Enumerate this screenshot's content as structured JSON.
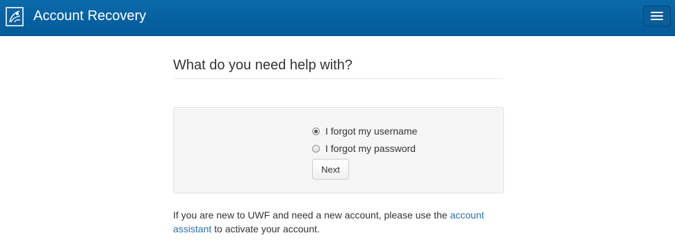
{
  "header": {
    "title": "Account Recovery",
    "logo_icon": "uwf-argo-logo",
    "menu_icon": "hamburger-menu-icon",
    "background_color": "#0565a5"
  },
  "main": {
    "heading": "What do you need help with?",
    "options": [
      {
        "label": "I forgot my username",
        "selected": true
      },
      {
        "label": "I forgot my password",
        "selected": false
      }
    ],
    "next_label": "Next"
  },
  "help": {
    "text_before": "If you are new to UWF and need a new account, please use the",
    "link_text": "account assistant",
    "text_after": "to activate your account.",
    "link_color": "#2a6fad"
  }
}
